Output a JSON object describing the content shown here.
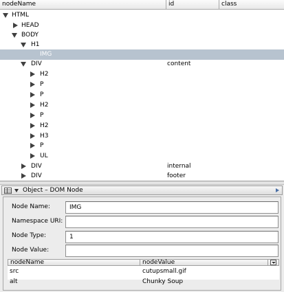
{
  "tree": {
    "columns": [
      "nodeName",
      "id",
      "class"
    ],
    "rows": [
      {
        "name": "HTML",
        "id": "",
        "class": ""
      },
      {
        "name": "HEAD",
        "id": "",
        "class": ""
      },
      {
        "name": "BODY",
        "id": "",
        "class": ""
      },
      {
        "name": "H1",
        "id": "",
        "class": ""
      },
      {
        "name": "IMG",
        "id": "",
        "class": ""
      },
      {
        "name": "DIV",
        "id": "content",
        "class": ""
      },
      {
        "name": "H2",
        "id": "",
        "class": ""
      },
      {
        "name": "P",
        "id": "",
        "class": ""
      },
      {
        "name": "P",
        "id": "",
        "class": ""
      },
      {
        "name": "H2",
        "id": "",
        "class": ""
      },
      {
        "name": "P",
        "id": "",
        "class": ""
      },
      {
        "name": "H2",
        "id": "",
        "class": ""
      },
      {
        "name": "H3",
        "id": "",
        "class": ""
      },
      {
        "name": "P",
        "id": "",
        "class": ""
      },
      {
        "name": "UL",
        "id": "",
        "class": ""
      },
      {
        "name": "DIV",
        "id": "internal",
        "class": ""
      },
      {
        "name": "DIV",
        "id": "footer",
        "class": ""
      }
    ]
  },
  "inspector": {
    "title": "Object – DOM Node",
    "fields": [
      {
        "label": "Node Name:",
        "value": "IMG"
      },
      {
        "label": "Namespace URI:",
        "value": ""
      },
      {
        "label": "Node Type:",
        "value": "1"
      },
      {
        "label": "Node Value:",
        "value": ""
      }
    ],
    "attributes": {
      "columns": [
        "nodeName",
        "nodeValue"
      ],
      "rows": [
        {
          "name": "src",
          "value": "cutupsmall.gif"
        },
        {
          "name": "alt",
          "value": "Chunky Soup"
        }
      ]
    }
  }
}
